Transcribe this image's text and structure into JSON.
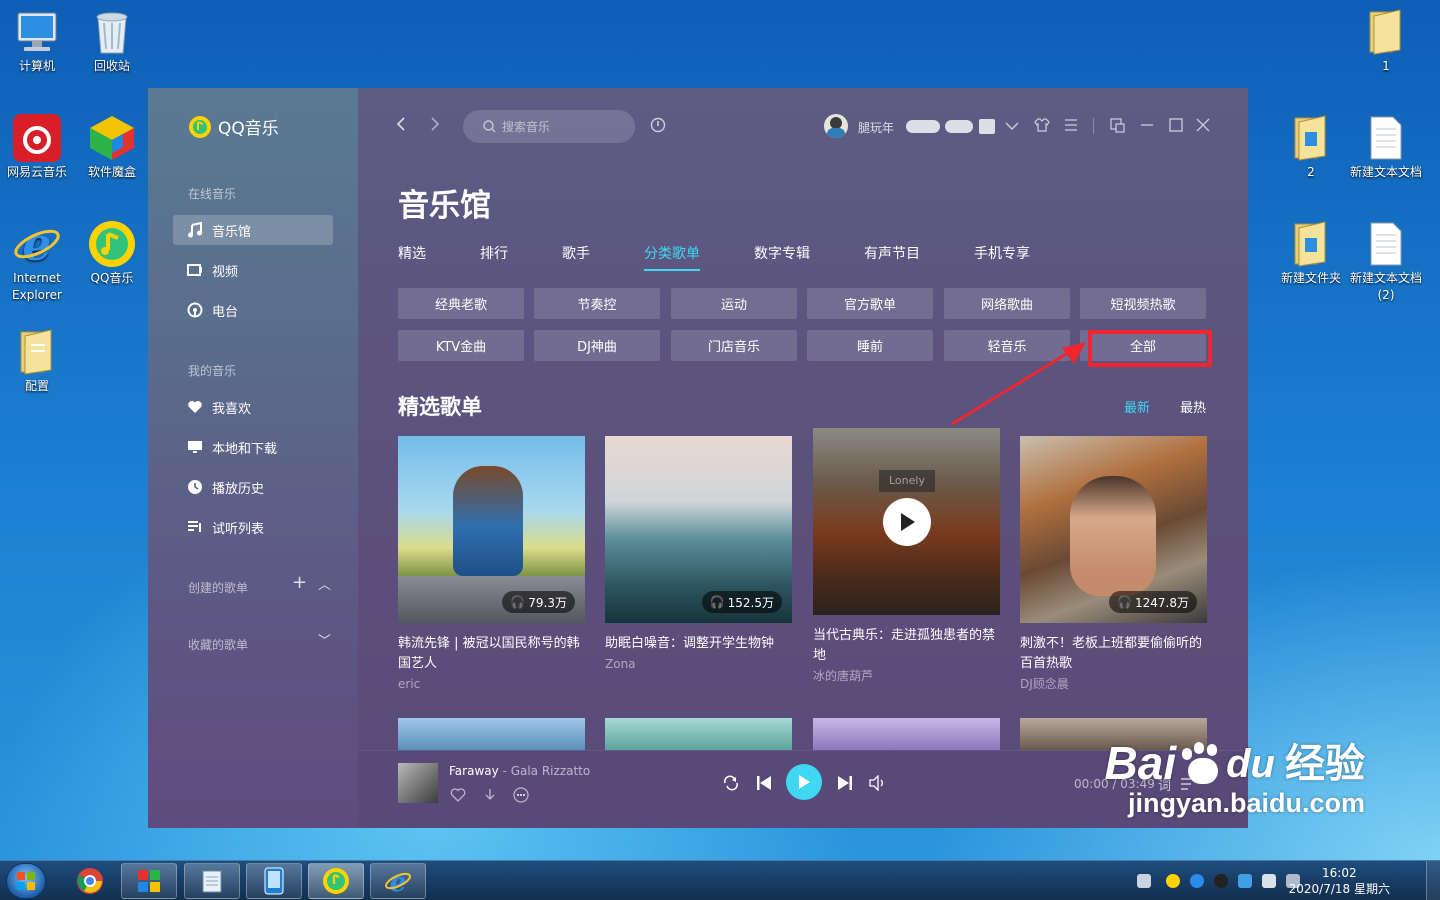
{
  "desktop": {
    "icons_left": [
      {
        "label": "计算机"
      },
      {
        "label": "回收站"
      },
      {
        "label": "网易云音乐"
      },
      {
        "label": "软件魔盒"
      },
      {
        "label": "Internet Explorer"
      },
      {
        "label": "QQ音乐"
      },
      {
        "label": "配置"
      }
    ],
    "icons_right": [
      {
        "label": "1"
      },
      {
        "label": "2"
      },
      {
        "label": "新建文本文档"
      },
      {
        "label": "新建文件夹"
      },
      {
        "label": "新建文本文档 (2)"
      }
    ]
  },
  "app": {
    "name": "QQ音乐",
    "sidebar": {
      "section_online": "在线音乐",
      "online_items": [
        {
          "label": "音乐馆",
          "icon": "music-note-icon"
        },
        {
          "label": "视频",
          "icon": "video-icon"
        },
        {
          "label": "电台",
          "icon": "radio-icon"
        }
      ],
      "section_mine": "我的音乐",
      "mine_items": [
        {
          "label": "我喜欢",
          "icon": "heart-icon"
        },
        {
          "label": "本地和下载",
          "icon": "monitor-icon"
        },
        {
          "label": "播放历史",
          "icon": "clock-icon"
        },
        {
          "label": "试听列表",
          "icon": "playlist-icon"
        }
      ],
      "section_created": "创建的歌单",
      "section_collected": "收藏的歌单"
    },
    "topbar": {
      "search_placeholder": "搜索音乐",
      "username": "腿玩年"
    },
    "page_title": "音乐馆",
    "tabs": [
      {
        "label": "精选"
      },
      {
        "label": "排行"
      },
      {
        "label": "歌手"
      },
      {
        "label": "分类歌单"
      },
      {
        "label": "数字专辑"
      },
      {
        "label": "有声节目"
      },
      {
        "label": "手机专享"
      }
    ],
    "active_tab": "分类歌单",
    "categories_row1": [
      "经典老歌",
      "节奏控",
      "运动",
      "官方歌单",
      "网络歌曲",
      "短视频热歌"
    ],
    "categories_row2": [
      "KTV金曲",
      "DJ神曲",
      "门店音乐",
      "睡前",
      "轻音乐",
      "全部"
    ],
    "section_title": "精选歌单",
    "sort": {
      "newest": "最新",
      "hottest": "最热",
      "active": "最新"
    },
    "playlists": [
      {
        "title": "韩流先锋 | 被冠以国民称号的韩国艺人",
        "author": "eric",
        "plays": "79.3万"
      },
      {
        "title": "助眠白噪音：调整开学生物钟",
        "author": "Zona",
        "plays": "152.5万"
      },
      {
        "title": "当代古典乐：走进孤独患者的禁地",
        "author": "冰的唐葫芦",
        "plays": "",
        "cover_text": "Lonely"
      },
      {
        "title": "刺激不！老板上班都要偷偷听的百首热歌",
        "author": "DJ顾念晨",
        "plays": "1247.8万"
      }
    ],
    "player": {
      "song": "Faraway",
      "separator": " - ",
      "artist": "Gala Rizzatto",
      "current_time": "00:00",
      "total_time": "03:49",
      "lyrics_label": "词"
    }
  },
  "taskbar": {
    "time": "16:02",
    "date": "2020/7/18 星期六"
  },
  "watermark": {
    "brand": "Bai",
    "brand_suffix": "du",
    "product": "经验",
    "url": "jingyan.baidu.com"
  },
  "colors": {
    "accent": "#3fd7f2",
    "highlight_box": "#ef2530",
    "window_bg": "#5b4a7c"
  }
}
